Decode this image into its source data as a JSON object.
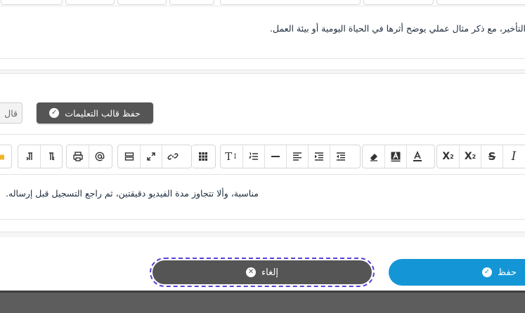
{
  "top_editor": {
    "text": "التأخير، مع ذكر مثال عملي يوضح أثرها في الحياة اليومية أو بيئة العمل."
  },
  "template_actions": {
    "save_label": "حفظ قالب التعليمات",
    "load_label": "قال"
  },
  "editor": {
    "toolbar": [
      {
        "name": "italic-icon",
        "glyph": "I"
      },
      {
        "name": "strikethrough-icon",
        "glyph": "S"
      },
      {
        "name": "subscript-icon",
        "glyph": "X₂"
      },
      {
        "name": "superscript-icon",
        "glyph": "X²"
      },
      {
        "name": "font-color-icon",
        "glyph": "A"
      },
      {
        "name": "background-color-icon",
        "glyph": "A"
      },
      {
        "name": "eraser-icon",
        "glyph": "⌫"
      },
      {
        "name": "indent-icon",
        "glyph": "⇥"
      },
      {
        "name": "outdent-icon",
        "glyph": "⇤"
      },
      {
        "name": "align-icon",
        "glyph": "≡"
      },
      {
        "name": "horizontal-rule-icon",
        "glyph": "—"
      },
      {
        "name": "ordered-list-icon",
        "glyph": "☰"
      },
      {
        "name": "text-size-icon",
        "glyph": "T↕"
      },
      {
        "name": "table-icon",
        "glyph": "▦"
      },
      {
        "name": "link-icon",
        "glyph": "🔗"
      },
      {
        "name": "fullscreen-icon",
        "glyph": "⤢"
      },
      {
        "name": "template-icon",
        "glyph": "▤"
      },
      {
        "name": "mention-icon",
        "glyph": "@"
      },
      {
        "name": "print-icon",
        "glyph": "⎙"
      },
      {
        "name": "ltr-icon",
        "glyph": "¶"
      },
      {
        "name": "rtl-icon",
        "glyph": "¶"
      },
      {
        "name": "folder-icon",
        "glyph": "■"
      }
    ],
    "text": "مناسبة، وألا تتجاوز مدة الفيديو دقيقتين، ثم راجع التسجيل قبل إرساله."
  },
  "footer": {
    "cancel_label": "إلغاء",
    "save_label": "حفظ"
  },
  "colors": {
    "primary": "#1496d6",
    "dark_button": "#555555",
    "focus_ring": "#5a3fd6"
  }
}
